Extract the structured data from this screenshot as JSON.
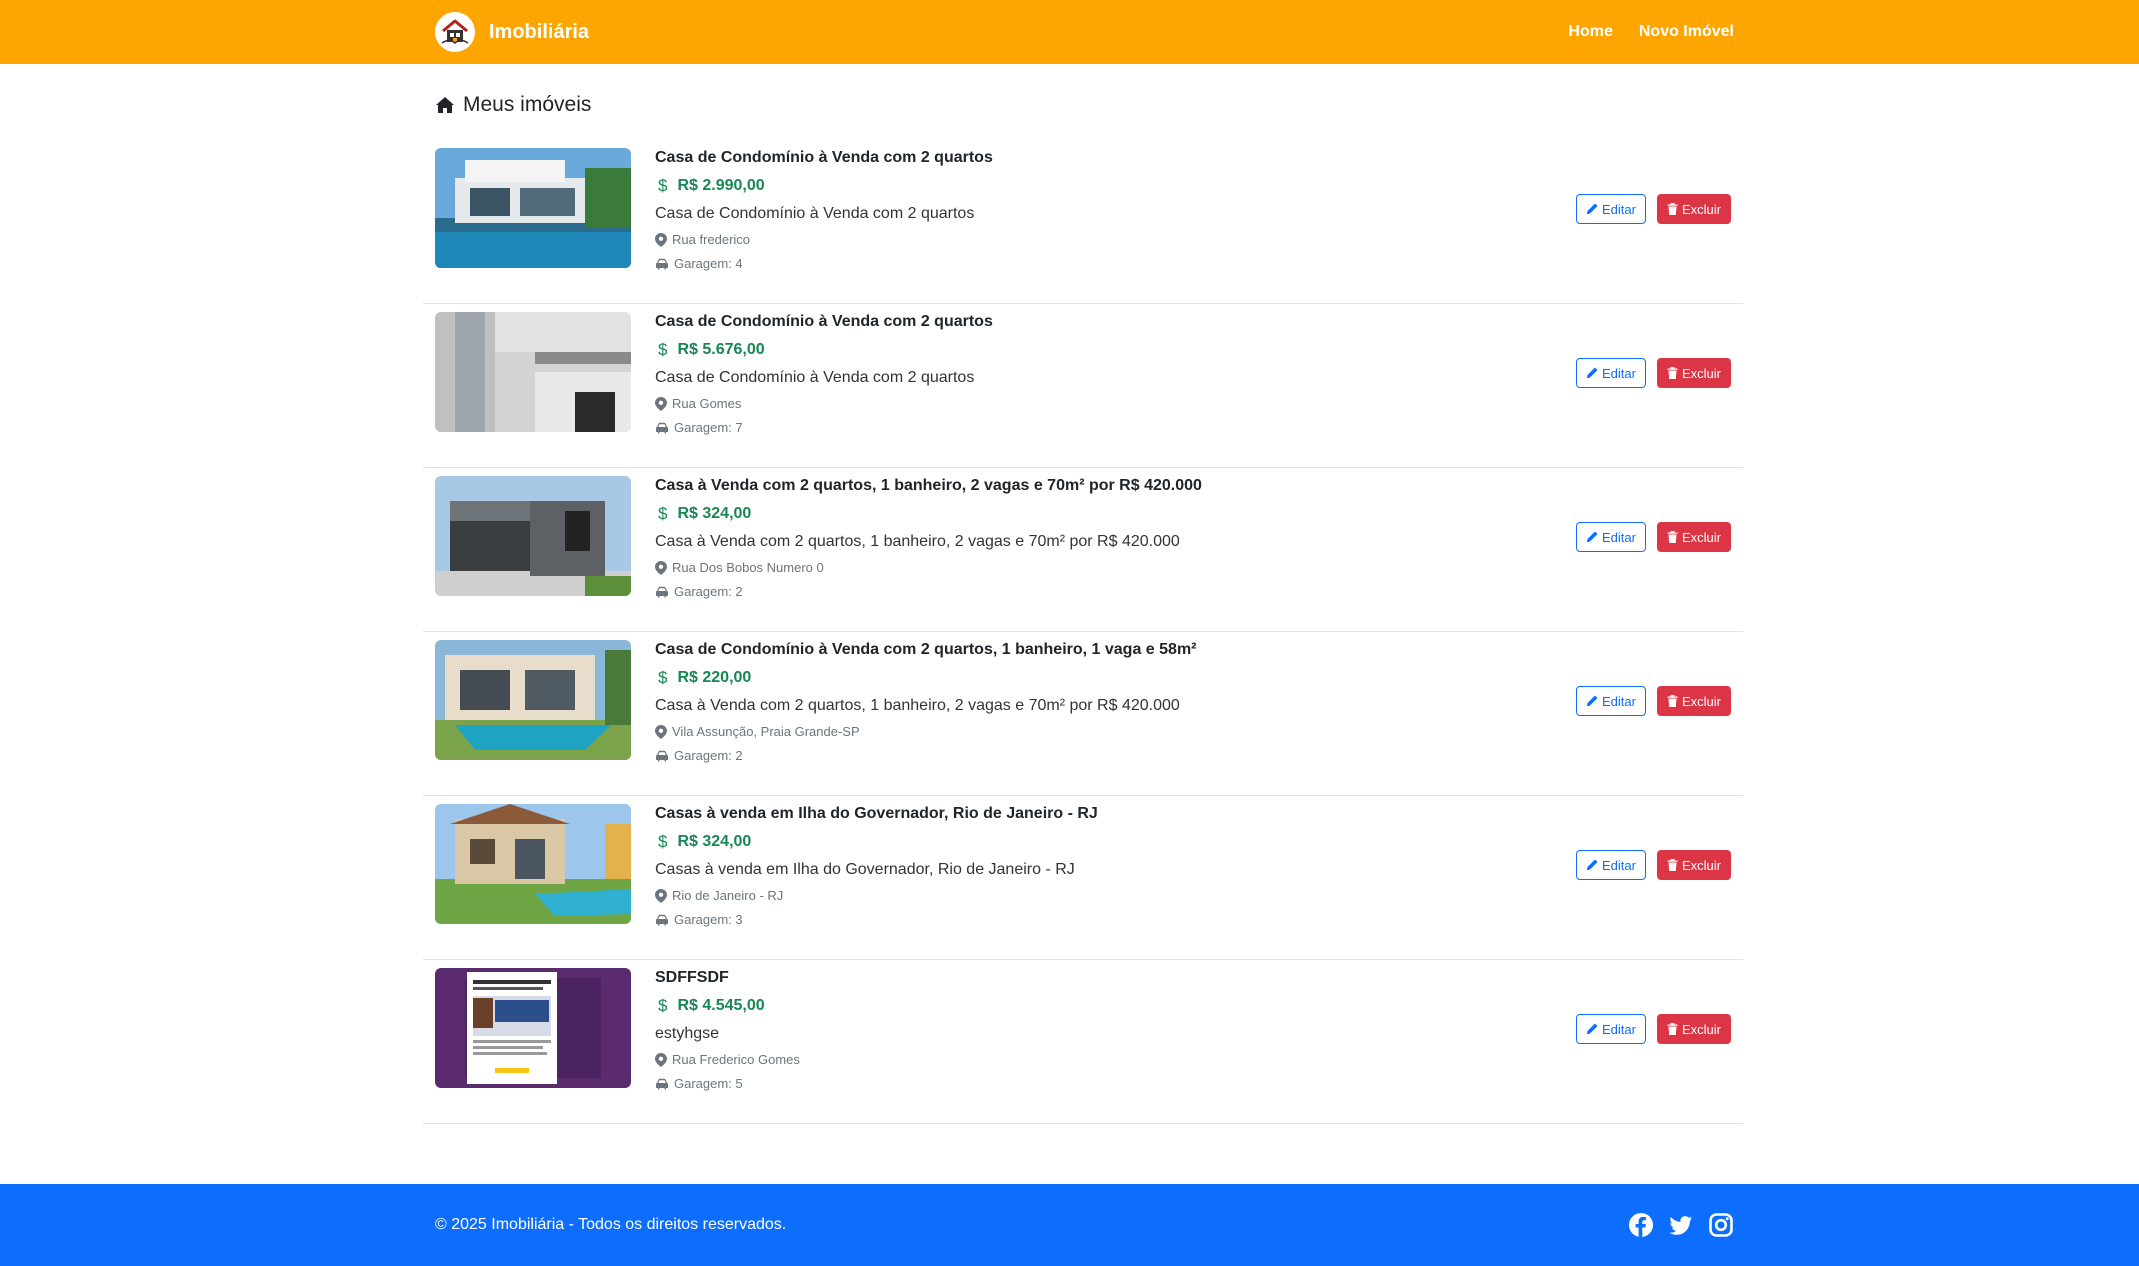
{
  "navbar": {
    "brand": "Imobiliária",
    "links": [
      "Home",
      "Novo Imóvel"
    ]
  },
  "page": {
    "title": "Meus imóveis"
  },
  "buttons": {
    "edit": "Editar",
    "delete": "Excluir"
  },
  "properties": [
    {
      "title": "Casa de Condomínio à Venda com 2 quartos",
      "price": "R$ 2.990,00",
      "description": "Casa de Condomínio à Venda com 2 quartos",
      "address": "Rua frederico",
      "garage": "Garagem: 4",
      "image": "modern house with pool"
    },
    {
      "title": "Casa de Condomínio à Venda com 2 quartos",
      "price": "R$ 5.676,00",
      "description": "Casa de Condomínio à Venda com 2 quartos",
      "address": "Rua Gomes",
      "garage": "Garagem: 7",
      "image": "modern building facade"
    },
    {
      "title": "Casa à Venda com 2 quartos, 1 banheiro, 2 vagas e 70m² por R$ 420.000",
      "price": "R$ 324,00",
      "description": "Casa à Venda com 2 quartos, 1 banheiro, 2 vagas e 70m² por R$ 420.000",
      "address": "Rua Dos Bobos Numero 0",
      "garage": "Garagem: 2",
      "image": "gray modern house"
    },
    {
      "title": "Casa de Condomínio à Venda com 2 quartos, 1 banheiro, 1 vaga e 58m²",
      "price": "R$ 220,00",
      "description": "Casa à Venda com 2 quartos, 1 banheiro, 2 vagas e 70m² por R$ 420.000",
      "address": "Vila Assunção, Praia Grande-SP",
      "garage": "Garagem: 2",
      "image": "house with pool and lawn"
    },
    {
      "title": "Casas à venda em Ilha do Governador, Rio de Janeiro - RJ",
      "price": "R$ 324,00",
      "description": "Casas à venda em Ilha do Governador, Rio de Janeiro - RJ",
      "address": "Rio de Janeiro - RJ",
      "garage": "Garagem: 3",
      "image": "two-story house with pool"
    },
    {
      "title": "SDFFSDF",
      "price": "R$ 4.545,00",
      "description": "estyhgse",
      "address": "Rua Frederico Gomes",
      "garage": "Garagem: 5",
      "image": "webpage screenshot"
    }
  ],
  "footer": {
    "copyright": "© 2025 Imobiliária - Todos os direitos reservados.",
    "social": [
      "facebook-icon",
      "twitter-icon",
      "instagram-icon"
    ]
  },
  "colors": {
    "navbar": "#ffa500",
    "footer": "#0d6efd",
    "price": "#198754",
    "edit": "#0d6efd",
    "delete": "#dc3545"
  }
}
